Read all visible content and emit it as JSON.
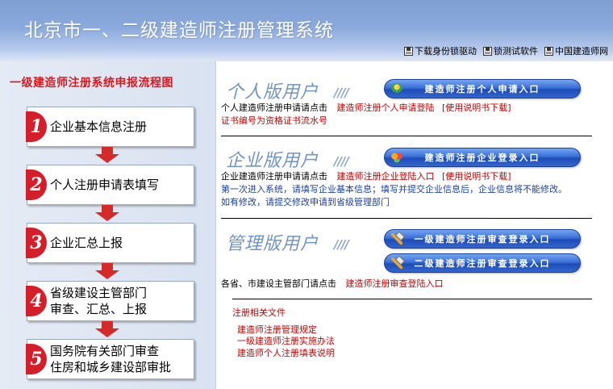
{
  "header": {
    "title": "北京市一、二级建造师注册管理系统",
    "links": [
      "下载身份锁驱动",
      "锁测试软件",
      "中国建造师网"
    ]
  },
  "flow": {
    "title": "一级建造师注册系统申报流程图",
    "steps": [
      {
        "num": "1",
        "label": "企业基本信息注册"
      },
      {
        "num": "2",
        "label": "个人注册申请表填写"
      },
      {
        "num": "3",
        "label": "企业汇总上报"
      },
      {
        "num": "4",
        "label": "省级建设主管部门\n审查、汇总、上报"
      },
      {
        "num": "5",
        "label": "国务院有关部门审查\n住房和城乡建设部审批"
      }
    ]
  },
  "personal": {
    "title": "个人版用户",
    "slashes": "////",
    "button": "建造师注册个人申请入口",
    "line1_text": "个人建造师注册申请请点击",
    "line1_link": "建造师注册个人申请登陆",
    "line1_manual": "[使用说明书下载]",
    "note": "证书编号为资格证书流水号"
  },
  "enterprise": {
    "title": "企业版用户",
    "slashes": "////",
    "button": "建造师注册企业登录入口",
    "line1_text": "企业建造师注册申请请点击",
    "line1_link": "建造师注册企业登陆入口",
    "line1_manual": "[使用说明书下载]",
    "note1": "第一次进入系统，请填写企业基本信息；填写并提交企业信息后，企业信息将不能修改。",
    "note2": "如有修改，请提交修改申请到省级管理部门"
  },
  "admin": {
    "title": "管理版用户",
    "slashes": "////",
    "button1": "一级建造师注册审查登录入口",
    "button2": "二级建造师注册审查登录入口",
    "line1_text": "各省、市建设主管部门请点击",
    "line1_link": "建造师注册审查登陆入口"
  },
  "docs": {
    "title": "注册相关文件",
    "items": [
      "建造师注册管理规定",
      "一级建造师注册实施办法",
      "建造师个人注册填表说明"
    ]
  },
  "colors": {
    "header_bg": "#8aa9dc",
    "flow_red": "#d71920",
    "section_blue": "#7094c6",
    "link_red": "#cc0000",
    "note_blue": "#1a3fa8"
  }
}
